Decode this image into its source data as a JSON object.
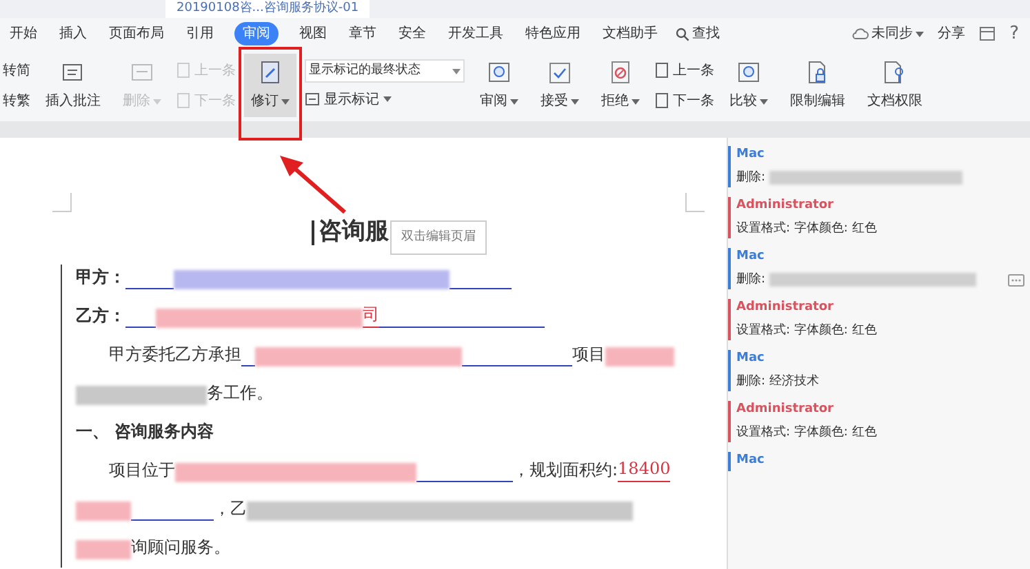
{
  "document_tab": {
    "title": "20190108咨...咨询服务协议-01"
  },
  "menu": [
    {
      "label": "开始",
      "selected": false
    },
    {
      "label": "插入",
      "selected": false
    },
    {
      "label": "页面布局",
      "selected": false
    },
    {
      "label": "引用",
      "selected": false
    },
    {
      "label": "审阅",
      "selected": true
    },
    {
      "label": "视图",
      "selected": false
    },
    {
      "label": "章节",
      "selected": false
    },
    {
      "label": "安全",
      "selected": false
    },
    {
      "label": "开发工具",
      "selected": false
    },
    {
      "label": "特色应用",
      "selected": false
    },
    {
      "label": "文档助手",
      "selected": false
    }
  ],
  "search": {
    "label": "查找"
  },
  "account": {
    "sync": "未同步",
    "share": "分享",
    "help": "?"
  },
  "ribbon": [
    {
      "kind": "stack",
      "items": [
        {
          "label": "转简",
          "disabled": false
        },
        {
          "label": "转繁",
          "disabled": false
        }
      ]
    },
    {
      "kind": "big",
      "label": "插入批注",
      "disabled": false,
      "dropdown": false,
      "highlighted": false
    },
    {
      "kind": "big",
      "label": "删除",
      "disabled": true,
      "dropdown": true,
      "highlighted": false
    },
    {
      "kind": "stack",
      "items": [
        {
          "label": "上一条",
          "disabled": true
        },
        {
          "label": "下一条",
          "disabled": true
        }
      ]
    },
    {
      "kind": "big",
      "label": "修订",
      "disabled": false,
      "dropdown": true,
      "highlighted": true
    },
    {
      "kind": "markup",
      "select": "显示标记的最终状态",
      "toggle": "显示标记"
    },
    {
      "kind": "big",
      "label": "审阅",
      "disabled": false,
      "dropdown": true,
      "highlighted": false
    },
    {
      "kind": "big",
      "label": "接受",
      "disabled": false,
      "dropdown": true,
      "highlighted": false
    },
    {
      "kind": "big",
      "label": "拒绝",
      "disabled": false,
      "dropdown": true,
      "highlighted": false
    },
    {
      "kind": "stack",
      "items": [
        {
          "label": "上一条",
          "disabled": false
        },
        {
          "label": "下一条",
          "disabled": false
        }
      ]
    },
    {
      "kind": "big",
      "label": "比较",
      "disabled": false,
      "dropdown": true,
      "highlighted": false
    },
    {
      "kind": "big",
      "label": "限制编辑",
      "disabled": false,
      "dropdown": false,
      "highlighted": false
    },
    {
      "kind": "big",
      "label": "文档权限",
      "disabled": false,
      "dropdown": false,
      "highlighted": false
    }
  ],
  "tooltip": "双击编辑页眉",
  "document": {
    "title": "咨询服",
    "paragraphs": [
      {
        "indented": false,
        "bold": true,
        "segments": [
          {
            "kind": "text",
            "text": "甲方："
          },
          {
            "kind": "blank"
          },
          {
            "kind": "redacted",
            "color": "#b8b8f0"
          },
          {
            "kind": "blank"
          }
        ]
      },
      {
        "indented": false,
        "bold": true,
        "segments": [
          {
            "kind": "text",
            "text": "乙方："
          },
          {
            "kind": "blank"
          },
          {
            "kind": "redacted",
            "color": "#f6b3ba"
          },
          {
            "kind": "inserted",
            "text": "司"
          },
          {
            "kind": "blank"
          }
        ]
      },
      {
        "indented": true,
        "bold": false,
        "segments": [
          {
            "kind": "text",
            "text": "甲方委托乙方承担"
          },
          {
            "kind": "blank"
          },
          {
            "kind": "redacted",
            "color": "#f6b3ba"
          },
          {
            "kind": "blank"
          },
          {
            "kind": "text",
            "text": "项目"
          },
          {
            "kind": "redacted",
            "color": "#f6b3ba"
          }
        ]
      },
      {
        "indented": false,
        "bold": false,
        "segments": [
          {
            "kind": "redacted",
            "color": "#c8c8c8"
          },
          {
            "kind": "text",
            "text": "务工作。"
          }
        ]
      },
      {
        "indented": false,
        "bold": true,
        "segments": [
          {
            "kind": "text",
            "text": "一、 咨询服务内容"
          }
        ]
      },
      {
        "indented": true,
        "bold": false,
        "segments": [
          {
            "kind": "text",
            "text": "项目位于"
          },
          {
            "kind": "redacted",
            "color": "#f6b3ba"
          },
          {
            "kind": "blank"
          },
          {
            "kind": "text",
            "text": "，规划面积约:"
          },
          {
            "kind": "inserted",
            "text": "18400"
          }
        ]
      },
      {
        "indented": false,
        "bold": false,
        "segments": [
          {
            "kind": "redacted",
            "color": "#f6b3ba"
          },
          {
            "kind": "blank"
          },
          {
            "kind": "text",
            "text": "，乙"
          },
          {
            "kind": "redacted",
            "color": "#c8c8c8"
          }
        ]
      },
      {
        "indented": false,
        "bold": false,
        "segments": [
          {
            "kind": "redacted",
            "color": "#f6b3ba"
          },
          {
            "kind": "text",
            "text": "询顾问服务。"
          }
        ]
      }
    ]
  },
  "revisions": [
    {
      "author": "Mac",
      "color": "#3b7dd8",
      "action": "删除:",
      "redacted": true
    },
    {
      "author": "Administrator",
      "color": "#d9535f",
      "action": "设置格式: 字体颜色: 红色"
    },
    {
      "author": "Mac",
      "color": "#3b7dd8",
      "action": "删除:",
      "redacted": true,
      "more": true
    },
    {
      "author": "Administrator",
      "color": "#d9535f",
      "action": "设置格式: 字体颜色: 红色"
    },
    {
      "author": "Mac",
      "color": "#3b7dd8",
      "action": "删除: 经济技术"
    },
    {
      "author": "Administrator",
      "color": "#d9535f",
      "action": "设置格式: 字体颜色: 红色"
    },
    {
      "author": "Mac",
      "color": "#3b7dd8"
    }
  ]
}
